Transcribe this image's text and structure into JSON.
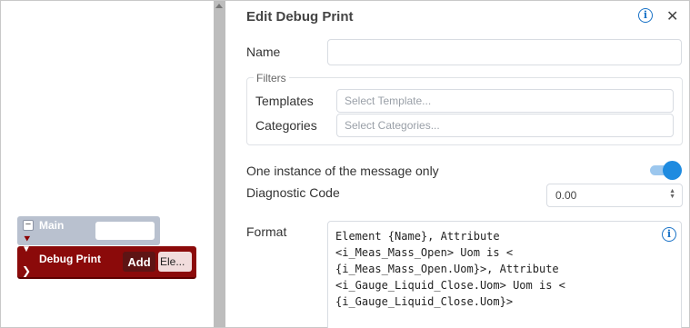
{
  "canvas": {
    "main_block": {
      "label": "Main",
      "field_value": ""
    },
    "debug_block": {
      "label": "Debug Print",
      "add_label": "Add",
      "element_value": "Ele..."
    }
  },
  "panel": {
    "title": "Edit Debug Print",
    "info_icon": "info-icon",
    "close_icon": "close-icon",
    "name": {
      "label": "Name",
      "value": ""
    },
    "filters": {
      "legend": "Filters",
      "templates_label": "Templates",
      "templates_placeholder": "Select Template...",
      "categories_label": "Categories",
      "categories_placeholder": "Select Categories..."
    },
    "one_instance": {
      "label": "One instance of the message only",
      "enabled": true
    },
    "diagnostic_code": {
      "label": "Diagnostic Code",
      "value": "0.00"
    },
    "format": {
      "label": "Format",
      "value": "Element {Name}, Attribute\n<i_Meas_Mass_Open> Uom is <\n{i_Meas_Mass_Open.Uom}>, Attribute\n<i_Gauge_Liquid_Close.Uom> Uom is <\n{i_Gauge_Liquid_Close.Uom}>"
    }
  },
  "colors": {
    "accent": "#1e8be0",
    "debug_block": "#8b0a0a",
    "main_block": "#b9c1cf"
  }
}
